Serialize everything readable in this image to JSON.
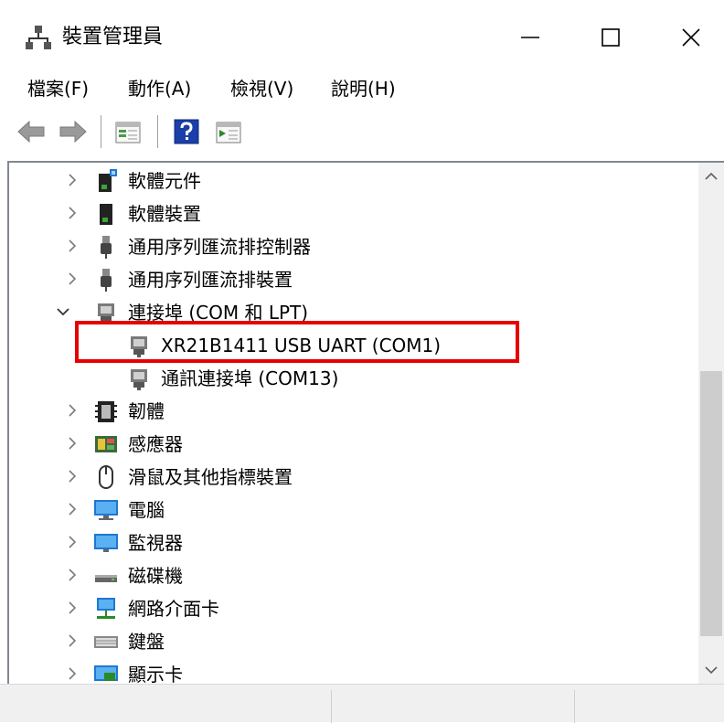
{
  "window": {
    "title": "裝置管理員",
    "controls": [
      "minimize",
      "maximize",
      "close"
    ]
  },
  "menu": {
    "items": [
      {
        "label": "檔案(F)"
      },
      {
        "label": "動作(A)"
      },
      {
        "label": "檢視(V)"
      },
      {
        "label": "說明(H)"
      }
    ]
  },
  "toolbar": {
    "buttons": [
      "back-icon",
      "forward-icon",
      "properties-icon",
      "help-icon",
      "update-driver-icon"
    ]
  },
  "tree": {
    "items": [
      {
        "label": "軟體元件",
        "expanded": false,
        "icon": "software-component-icon"
      },
      {
        "label": "軟體裝置",
        "expanded": false,
        "icon": "software-device-icon"
      },
      {
        "label": "通用序列匯流排控制器",
        "expanded": false,
        "icon": "usb-controller-icon"
      },
      {
        "label": "通用序列匯流排裝置",
        "expanded": false,
        "icon": "usb-device-icon"
      },
      {
        "label": "連接埠 (COM 和 LPT)",
        "expanded": true,
        "icon": "port-icon",
        "children": [
          {
            "label": "XR21B1411 USB UART (COM1)",
            "icon": "port-icon",
            "highlighted": true
          },
          {
            "label": "通訊連接埠 (COM13)",
            "icon": "port-icon"
          }
        ]
      },
      {
        "label": "韌體",
        "expanded": false,
        "icon": "firmware-icon"
      },
      {
        "label": "感應器",
        "expanded": false,
        "icon": "sensor-icon"
      },
      {
        "label": "滑鼠及其他指標裝置",
        "expanded": false,
        "icon": "mouse-icon"
      },
      {
        "label": "電腦",
        "expanded": false,
        "icon": "computer-icon"
      },
      {
        "label": "監視器",
        "expanded": false,
        "icon": "monitor-icon"
      },
      {
        "label": "磁碟機",
        "expanded": false,
        "icon": "disk-drive-icon"
      },
      {
        "label": "網路介面卡",
        "expanded": false,
        "icon": "network-adapter-icon"
      },
      {
        "label": "鍵盤",
        "expanded": false,
        "icon": "keyboard-icon"
      },
      {
        "label": "顯示卡",
        "expanded": false,
        "icon": "display-adapter-icon"
      }
    ]
  },
  "colors": {
    "highlight_border": "#e60000",
    "accent_blue": "#1e78d2"
  }
}
